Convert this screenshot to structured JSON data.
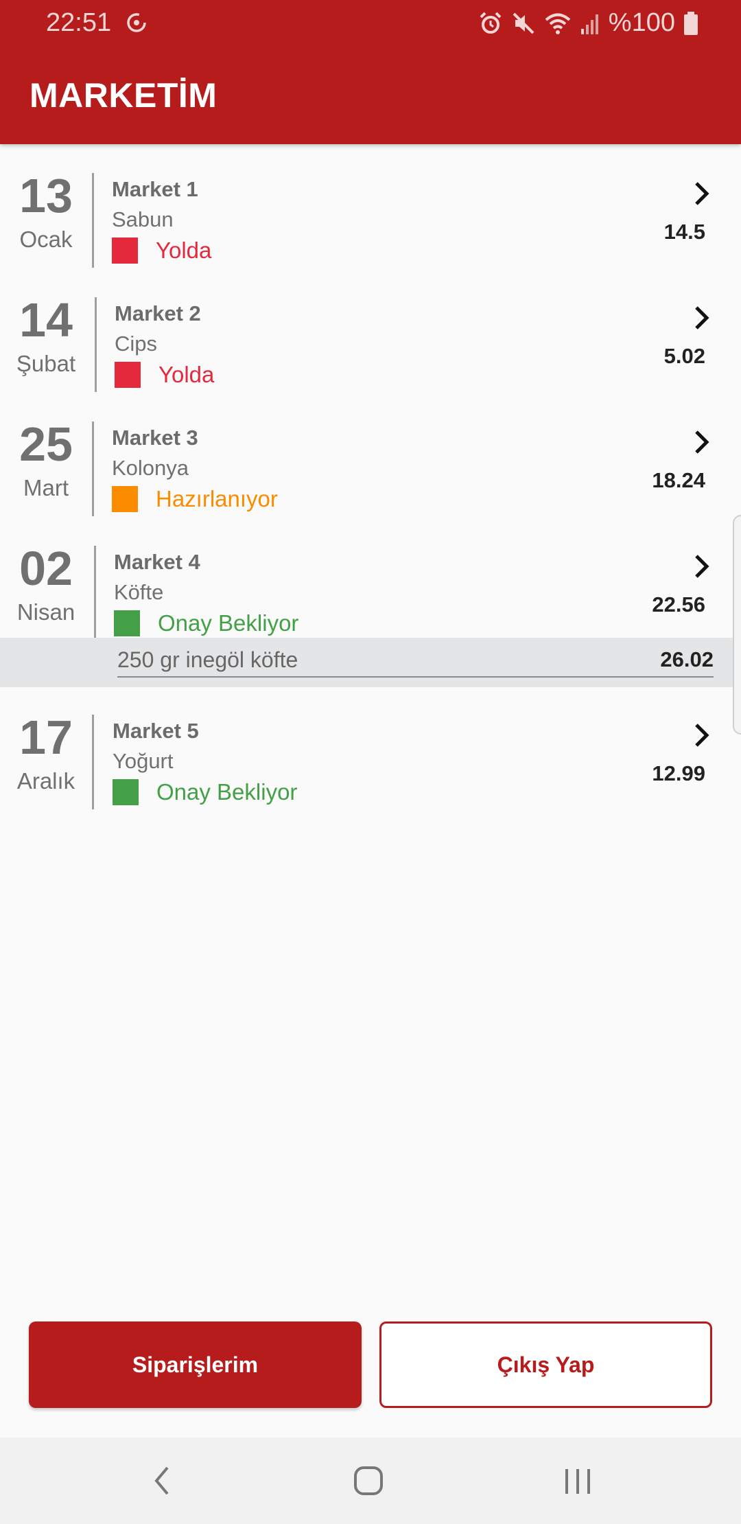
{
  "status_bar": {
    "time": "22:51",
    "battery": "%100"
  },
  "app": {
    "title": "MARKETİM"
  },
  "orders": [
    {
      "day": "13",
      "month": "Ocak",
      "market": "Market 1",
      "product": "Sabun",
      "status": "Yolda",
      "status_color": "#e3293b",
      "price": "14.5"
    },
    {
      "day": "14",
      "month": "Şubat",
      "market": "Market 2",
      "product": "Cips",
      "status": "Yolda",
      "status_color": "#e3293b",
      "price": "5.02"
    },
    {
      "day": "25",
      "month": "Mart",
      "market": "Market 3",
      "product": "Kolonya",
      "status": "Hazırlanıyor",
      "status_color": "#fb8c00",
      "price": "18.24"
    },
    {
      "day": "02",
      "month": "Nisan",
      "market": "Market 4",
      "product": "Köfte",
      "status": "Onay Bekliyor",
      "status_color": "#43a047",
      "price": "22.56"
    },
    {
      "day": "17",
      "month": "Aralık",
      "market": "Market 5",
      "product": "Yoğurt",
      "status": "Onay Bekliyor",
      "status_color": "#43a047",
      "price": "12.99"
    }
  ],
  "expanded_detail": {
    "name": "250 gr inegöl köfte",
    "price": "26.02"
  },
  "buttons": {
    "orders_label": "Siparişlerim",
    "logout_label": "Çıkış Yap"
  },
  "colors": {
    "primary": "#b71c1c"
  },
  "icons": {
    "chevron": "chevron-right-icon",
    "back": "back-icon",
    "home": "home-icon",
    "recent": "recent-apps-icon"
  }
}
